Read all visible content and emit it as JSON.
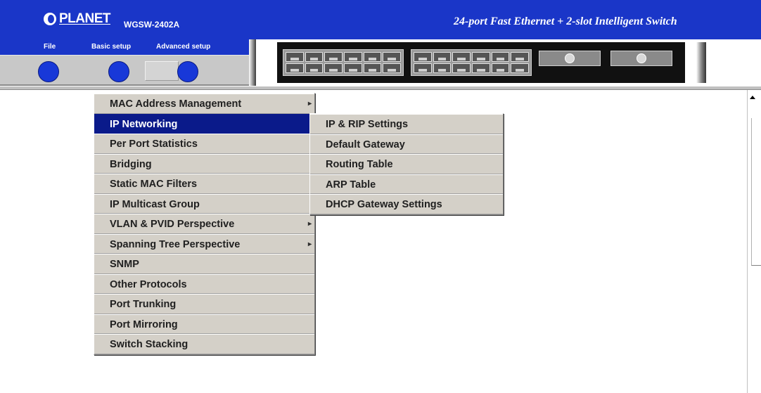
{
  "header": {
    "brand": "PLANET",
    "model": "WGSW-2402A",
    "tagline": "24-port Fast Ethernet + 2-slot Intelligent Switch"
  },
  "toolbar": {
    "file_label": "File",
    "basic_label": "Basic setup",
    "advanced_label": "Advanced setup"
  },
  "main_menu": {
    "items": [
      {
        "label": "MAC Address Management",
        "arrow": "▸"
      },
      {
        "label": "IP Networking",
        "arrow": ""
      },
      {
        "label": "Per Port Statistics",
        "arrow": ""
      },
      {
        "label": "Bridging",
        "arrow": ""
      },
      {
        "label": "Static MAC Filters",
        "arrow": "‹"
      },
      {
        "label": "IP Multicast Group",
        "arrow": ""
      },
      {
        "label": "VLAN & PVID Perspective",
        "arrow": "▸"
      },
      {
        "label": "Spanning Tree Perspective",
        "arrow": "▸"
      },
      {
        "label": "SNMP",
        "arrow": ""
      },
      {
        "label": "Other Protocols",
        "arrow": ""
      },
      {
        "label": "Port Trunking",
        "arrow": ""
      },
      {
        "label": "Port Mirroring",
        "arrow": ""
      },
      {
        "label": "Switch Stacking",
        "arrow": ""
      }
    ],
    "active_item": "IP Networking"
  },
  "sub_menu": {
    "items": [
      {
        "label": "IP & RIP Settings"
      },
      {
        "label": "Default Gateway"
      },
      {
        "label": "Routing Table"
      },
      {
        "label": "ARP Table"
      },
      {
        "label": "DHCP Gateway Settings"
      }
    ]
  },
  "colors": {
    "header_blue": "#1a36c8",
    "menu_face": "#d4d0c8",
    "active_item": "#0a1a8a",
    "button_blue": "#1838d8"
  }
}
